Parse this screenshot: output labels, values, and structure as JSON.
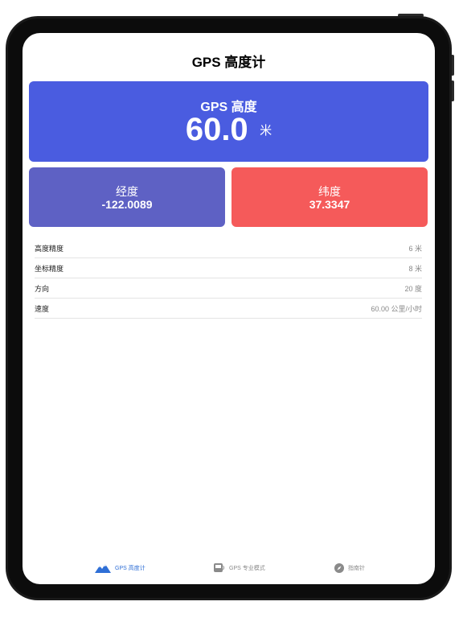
{
  "nav": {
    "title": "GPS 高度计"
  },
  "altitude": {
    "label": "GPS 高度",
    "value": "60.0",
    "unit": "米"
  },
  "longitude": {
    "label": "经度",
    "value": "-122.0089"
  },
  "latitude": {
    "label": "纬度",
    "value": "37.3347"
  },
  "info_rows": [
    {
      "key": "高度精度",
      "value": "6 米"
    },
    {
      "key": "坐标精度",
      "value": "8 米"
    },
    {
      "key": "方向",
      "value": "20 度"
    },
    {
      "key": "速度",
      "value": "60.00 公里/小时"
    }
  ],
  "tabs": [
    {
      "label": "GPS 高度计",
      "icon": "mountain-icon",
      "selected": true
    },
    {
      "label": "GPS 专业模式",
      "icon": "gps-device-icon",
      "selected": false
    },
    {
      "label": "指南针",
      "icon": "compass-icon",
      "selected": false
    }
  ],
  "colors": {
    "altitude_card": "#4a5ce0",
    "longitude_card": "#5e61c4",
    "latitude_card": "#f55a5a",
    "tab_active": "#2f6fd6",
    "tab_inactive": "#8a8a8a"
  }
}
